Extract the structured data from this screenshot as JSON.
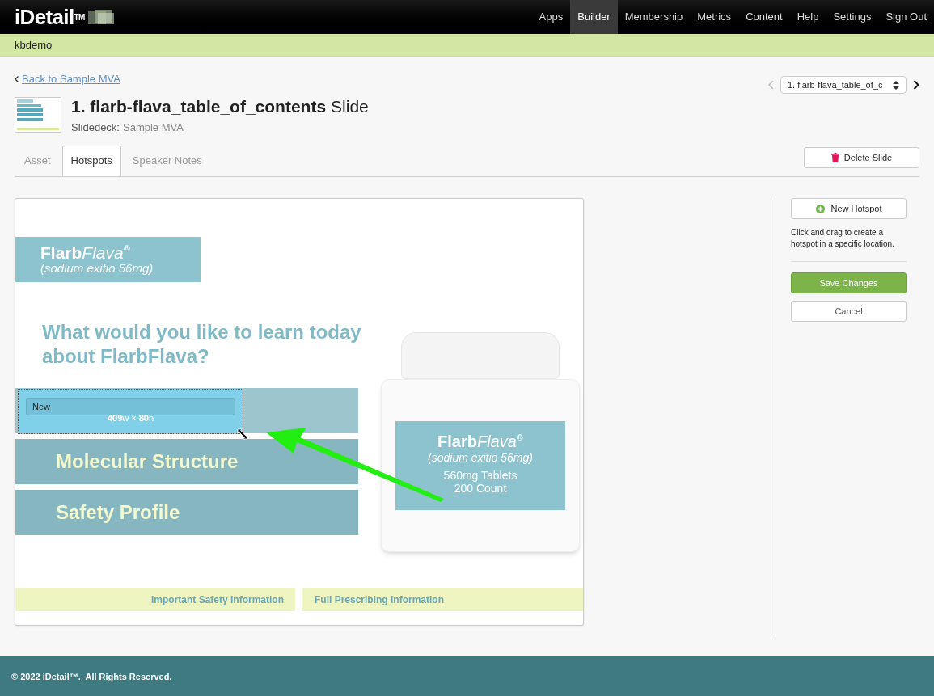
{
  "brand": {
    "name": "iDetail",
    "mark": "TM"
  },
  "nav": [
    {
      "label": "Apps",
      "selected": false
    },
    {
      "label": "Builder",
      "selected": true
    },
    {
      "label": "Membership",
      "selected": false
    },
    {
      "label": "Metrics",
      "selected": false
    },
    {
      "label": "Content",
      "selected": false
    },
    {
      "label": "Help",
      "selected": false
    },
    {
      "label": "Settings",
      "selected": false
    },
    {
      "label": "Sign Out",
      "selected": false
    }
  ],
  "account": "kbdemo",
  "back_link": "Back to Sample MVA",
  "slide_select": {
    "value": "1. flarb-flava_table_of_c"
  },
  "title": {
    "name": "1. flarb-flava_table_of_contents",
    "suffix": "Slide"
  },
  "subtitle": {
    "label": "Slidedeck:",
    "value": "Sample MVA"
  },
  "tabs": [
    {
      "label": "Asset",
      "selected": false
    },
    {
      "label": "Hotspots",
      "selected": true
    },
    {
      "label": "Speaker Notes",
      "selected": false
    }
  ],
  "delete_button": "Delete Slide",
  "slide": {
    "logo": {
      "bold": "Flarb",
      "light": "Flava",
      "mark": "®",
      "sub": "(sodium exitio 56mg)"
    },
    "question": "What would you like to learn today about FlarbFlava?",
    "menu": [
      "Molecular Structure",
      "Safety Profile"
    ],
    "bottle": {
      "bold": "Flarb",
      "light": "Flava",
      "mark": "®",
      "sub": "(sodium exitio 56mg)",
      "line1": "560mg Tablets",
      "line2": "200 Count"
    },
    "footer_links": [
      "Important Safety Information",
      "Full Prescribing Information"
    ]
  },
  "hotspot": {
    "label": "New",
    "size": "**409**w × **80**h"
  },
  "sidebar": {
    "new_button": "New Hotspot",
    "hint": "Click and drag to create a hotspot in a specific location.",
    "save_button": "Save Changes",
    "cancel_button": "Cancel"
  },
  "footer": "© 2022 iDetail™.  All Rights Reserved."
}
